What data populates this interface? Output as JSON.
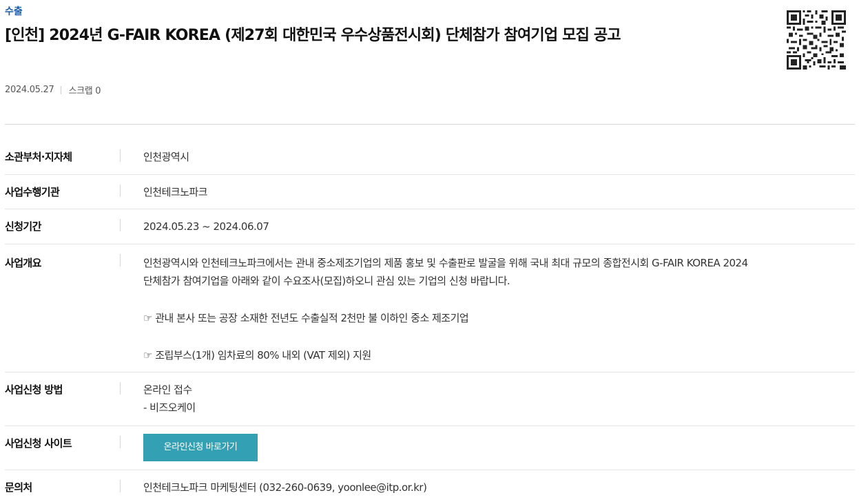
{
  "header": {
    "category": "수출",
    "title": "[인천] 2024년 G-FAIR KOREA (제27회 대한민국 우수상품전시회) 단체참가 참여기업 모집 공고",
    "date": "2024.05.27",
    "scrap": "스크랩 0"
  },
  "info": {
    "ministry": {
      "label": "소관부처·지자체",
      "value": "인천광역시"
    },
    "agency": {
      "label": "사업수행기관",
      "value": "인천테크노파크"
    },
    "period": {
      "label": "신청기간",
      "value": "2024.05.23 ~ 2024.06.07"
    },
    "overview": {
      "label": "사업개요",
      "line1": "인천광역시와 인천테크노파크에서는 관내 중소제조기업의 제품 홍보 및 수출판로 발굴을 위해 국내 최대 규모의 종합전시회 G-FAIR KOREA 2024",
      "line2": "단체참가 참여기업을 아래와 같이 수요조사(모집)하오니 관심 있는 기업의 신청 바랍니다.",
      "bullet1": "☞ 관내 본사 또는 공장 소재한 전년도 수출실적 2천만 불 이하인 중소 제조기업",
      "bullet2": "☞ 조립부스(1개) 임차료의 80% 내외 (VAT 제외) 지원"
    },
    "method": {
      "label": "사업신청 방법",
      "line1": "온라인 접수",
      "line2": "- 비즈오케이"
    },
    "site": {
      "label": "사업신청 사이트",
      "button_label": "온라인신청 바로가기"
    },
    "contact": {
      "label": "문의처",
      "value": "인천테크노파크 마케팅센터 (032-260-0639, yoonlee@itp.or.kr)"
    }
  },
  "icons": {
    "qr": "qr-code-icon"
  },
  "colors": {
    "accent": "#1a5da8",
    "button": "#33a0b3"
  }
}
